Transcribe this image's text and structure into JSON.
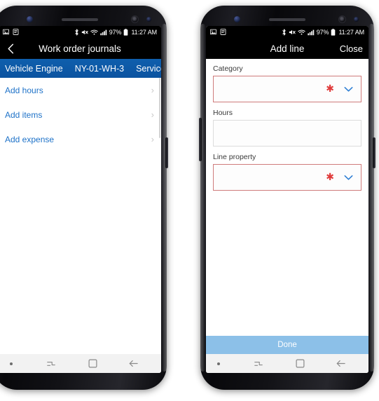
{
  "status_bar": {
    "icons_left": [
      "image-icon",
      "document-icon"
    ],
    "icons_right": [
      "bluetooth-icon",
      "mute-icon",
      "wifi-icon",
      "signal-icon"
    ],
    "battery_percent": "97%",
    "battery_icon": "battery-icon",
    "time": "11:27 AM"
  },
  "left_phone": {
    "title_bar": {
      "back_icon": "back-chevron-icon",
      "title": "Work order journals"
    },
    "context_bar": {
      "items": [
        "Vehicle Engine",
        "NY-01-WH-3",
        "Service"
      ]
    },
    "list": [
      {
        "label": "Add hours",
        "chevron": "›"
      },
      {
        "label": "Add items",
        "chevron": "›"
      },
      {
        "label": "Add expense",
        "chevron": "›"
      }
    ],
    "nav_bar": {
      "dot": "recent-dot-icon",
      "recents": "recents-icon",
      "home": "home-square-icon",
      "back": "back-arrow-icon"
    }
  },
  "right_phone": {
    "title_bar": {
      "title": "Add line",
      "close_label": "Close"
    },
    "fields": [
      {
        "label": "Category",
        "value": "",
        "required": true,
        "required_marker": "✱",
        "dropdown_icon": "chevron-down-icon"
      },
      {
        "label": "Hours",
        "value": "",
        "required": false,
        "required_marker": "",
        "dropdown_icon": ""
      },
      {
        "label": "Line property",
        "value": "",
        "required": true,
        "required_marker": "✱",
        "dropdown_icon": "chevron-down-icon"
      }
    ],
    "done_button": {
      "label": "Done"
    },
    "nav_bar": {
      "dot": "recent-dot-icon",
      "recents": "recents-icon",
      "home": "home-square-icon",
      "back": "back-arrow-icon"
    }
  },
  "colors": {
    "context_bar_blue": "#0c5aa6",
    "link_blue": "#1e72c8",
    "required_red": "#e03b3b",
    "required_border": "#cf7b7b",
    "done_blue": "#8cc0e8",
    "status_bar_black": "#000000"
  }
}
